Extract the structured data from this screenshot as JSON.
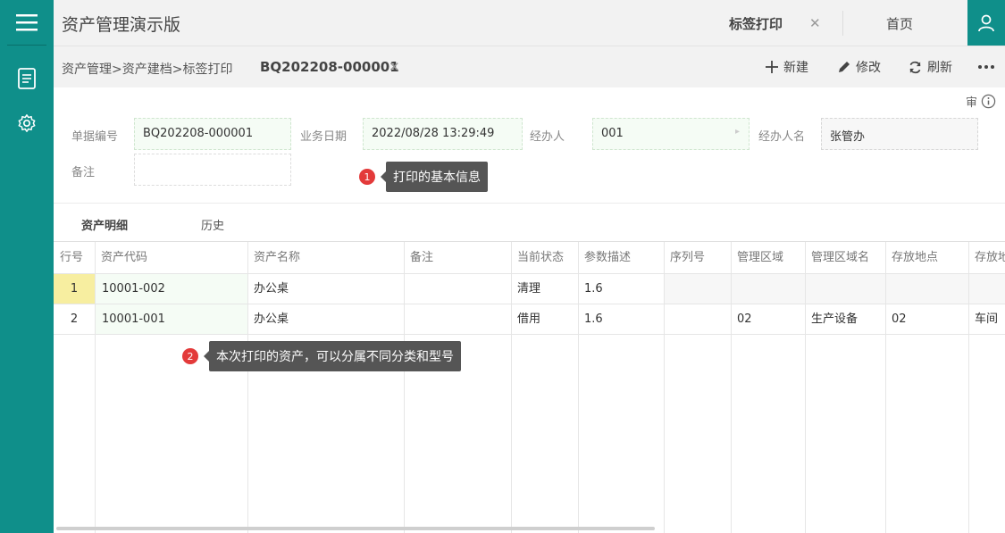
{
  "header": {
    "app_title": "资产管理演示版",
    "active_tab": "标签打印",
    "home_tab": "首页"
  },
  "toolbar": {
    "breadcrumb": "资产管理>资产建档>标签打印",
    "doc_no": "BQ202208-000001",
    "new_label": "新建",
    "edit_label": "修改",
    "refresh_label": "刷新"
  },
  "form": {
    "audit_label": "审",
    "doc_no_label": "单据编号",
    "doc_no_value": "BQ202208-000001",
    "date_label": "业务日期",
    "date_value": "2022/08/28 13:29:49",
    "handler_label": "经办人",
    "handler_value": "001",
    "handler_name_label": "经办人名",
    "handler_name_value": "张管办",
    "remark_label": "备注",
    "remark_value": ""
  },
  "tips": {
    "tip1_num": "1",
    "tip1_text": "打印的基本信息",
    "tip2_num": "2",
    "tip2_text": "本次打印的资产，可以分属不同分类和型号"
  },
  "detail_tabs": {
    "assets": "资产明细",
    "history": "历史"
  },
  "table": {
    "headers": [
      "行号",
      "资产代码",
      "资产名称",
      "备注",
      "当前状态",
      "参数描述",
      "序列号",
      "管理区域",
      "管理区域名",
      "存放地点",
      "存放地"
    ],
    "rows": [
      [
        "1",
        "10001-002",
        "办公桌",
        "",
        "清理",
        "1.6",
        "",
        "",
        "",
        "",
        ""
      ],
      [
        "2",
        "10001-001",
        "办公桌",
        "",
        "借用",
        "1.6",
        "",
        "02",
        "生产设备",
        "02",
        "车间"
      ]
    ]
  },
  "colors": {
    "accent": "#0f8f8a",
    "tip_bg": "#555555",
    "badge": "#e33a3a"
  }
}
